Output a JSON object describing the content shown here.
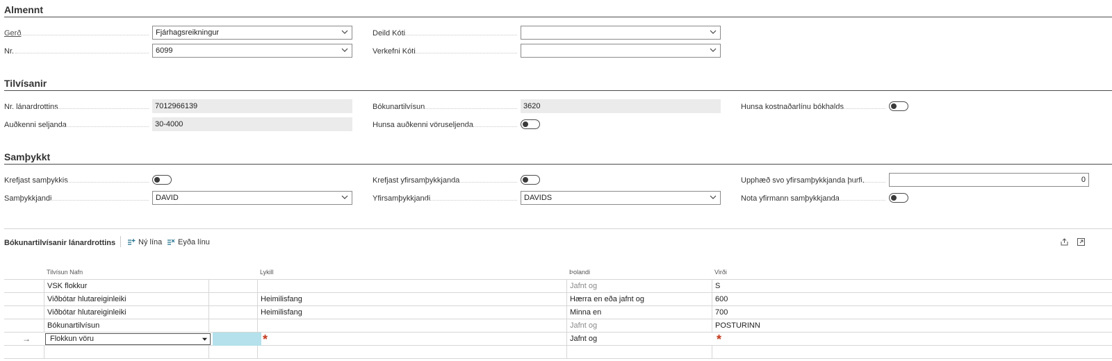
{
  "sections": {
    "general": "Almennt",
    "references": "Tilvísanir",
    "approval": "Samþykkt"
  },
  "general": {
    "type": {
      "label": "Gerð",
      "value": "Fjárhagsreikningur"
    },
    "no": {
      "label": "Nr.",
      "value": "6099"
    },
    "dept": {
      "label": "Deild Kóti",
      "value": ""
    },
    "project": {
      "label": "Verkefni Kóti",
      "value": ""
    }
  },
  "references": {
    "vendor_no": {
      "label": "Nr. lánardrottins",
      "value": "7012966139"
    },
    "seller_id": {
      "label": "Auðkenni seljanda",
      "value": "30-4000"
    },
    "posting_ref": {
      "label": "Bókunartilvísun",
      "value": "3620"
    },
    "ignore_seller_id": {
      "label": "Hunsa auðkenni vöruseljenda",
      "on": false
    },
    "ignore_cost_line": {
      "label": "Hunsa kostnaðarlínu bókhalds",
      "on": false
    }
  },
  "approval": {
    "require_approval": {
      "label": "Krefjast samþykkis",
      "on": false
    },
    "approver": {
      "label": "Samþykkjandi",
      "value": "DAVID"
    },
    "require_super": {
      "label": "Krefjast yfirsamþykkjanda",
      "on": false
    },
    "super_approver": {
      "label": "Yfirsamþykkjandi",
      "value": "DAVIDS"
    },
    "amount_super": {
      "label": "Upphæð svo yfirsamþykkjanda þurfi.",
      "value": "0"
    },
    "use_manager": {
      "label": "Nota yfirmann samþykkjanda",
      "on": false
    }
  },
  "lines_part": {
    "title": "Bókunartilvísanir lánardrottins",
    "new_line": "Ný lína",
    "delete_line": "Eyða línu",
    "columns": {
      "name": "Tilvísun Nafn",
      "key": "Lykill",
      "operator": "Þolandi",
      "value": "Virði"
    },
    "rows": [
      {
        "name": "VSK flokkur",
        "key": "",
        "operator": "Jafnt og",
        "value": "S",
        "muted_op": true
      },
      {
        "name": "Viðbótar hlutareiginleiki",
        "key": "Heimilisfang",
        "operator": "Hærra en eða jafnt og",
        "value": "600",
        "muted_op": false
      },
      {
        "name": "Viðbótar hlutareiginleiki",
        "key": "Heimilisfang",
        "operator": "Minna en",
        "value": "700",
        "muted_op": false
      },
      {
        "name": "Bókunartilvísun",
        "key": "",
        "operator": "Jafnt og",
        "value": "POSTURINN",
        "muted_op": true
      }
    ],
    "active_row": {
      "arrow": "→",
      "name": "Flokkun vöru",
      "operator": "Jafnt og",
      "required_mark": "*"
    }
  },
  "colors": {
    "accent": "#b4e1eb",
    "required": "#c4391d",
    "rule": "#4a4a4a"
  }
}
